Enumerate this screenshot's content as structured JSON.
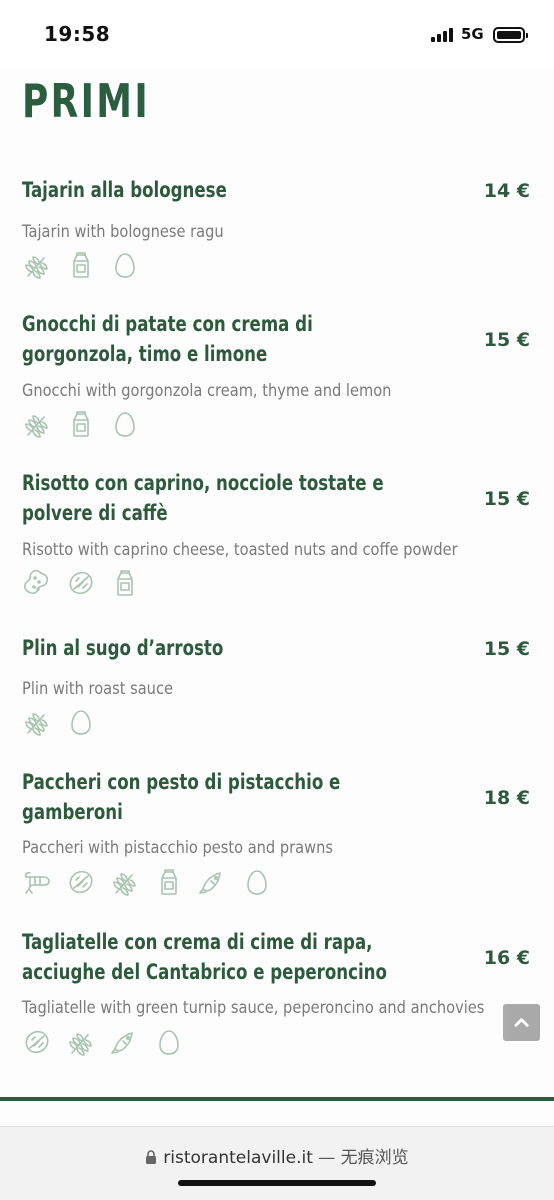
{
  "status_bar": {
    "time": "19:58",
    "network": "5G"
  },
  "page": {
    "title": "PRIMI"
  },
  "menu": [
    {
      "name": "Tajarin alla bolognese",
      "price": "14 €",
      "description": "Tajarin with bolognese ragu",
      "allergens": [
        "gluten-icon",
        "milk-icon",
        "egg-icon"
      ]
    },
    {
      "name": "Gnocchi di patate con crema di gorgonzola, timo e limone",
      "price": "15 €",
      "description": "Gnocchi with gorgonzola cream, thyme and lemon",
      "allergens": [
        "gluten-icon",
        "milk-icon",
        "egg-icon"
      ]
    },
    {
      "name": "Risotto con caprino, nocciole tostate e polvere di caffè",
      "price": "15 €",
      "description": "Risotto with caprino cheese, toasted nuts and coffe powder",
      "allergens": [
        "peanut-icon",
        "nuts-icon",
        "milk-icon"
      ]
    },
    {
      "name": "Plin al sugo d’arrosto",
      "price": "15 €",
      "description": "Plin with roast sauce",
      "allergens": [
        "gluten-icon",
        "egg-icon"
      ]
    },
    {
      "name": "Paccheri con pesto di pistacchio e gamberoni",
      "price": "18 €",
      "description": "Paccheri with pistacchio pesto and prawns",
      "allergens": [
        "crustacean-icon",
        "nuts-icon",
        "gluten-icon",
        "milk-icon",
        "fish-icon",
        "egg-icon"
      ]
    },
    {
      "name": "Tagliatelle con crema di cime di rapa, acciughe del Cantabrico e peperoncino",
      "price": "16 €",
      "description": "Tagliatelle with green turnip sauce, peperoncino and anchovies",
      "allergens": [
        "nuts-icon",
        "gluten-icon",
        "fish-icon",
        "egg-icon"
      ]
    }
  ],
  "browser": {
    "url": "ristorantelaville.it",
    "suffix": " — 无痕浏览"
  },
  "colors": {
    "accent": "#2a5e3f",
    "allergen_icon": "#a9c4b0",
    "description": "#7a7a7a"
  }
}
